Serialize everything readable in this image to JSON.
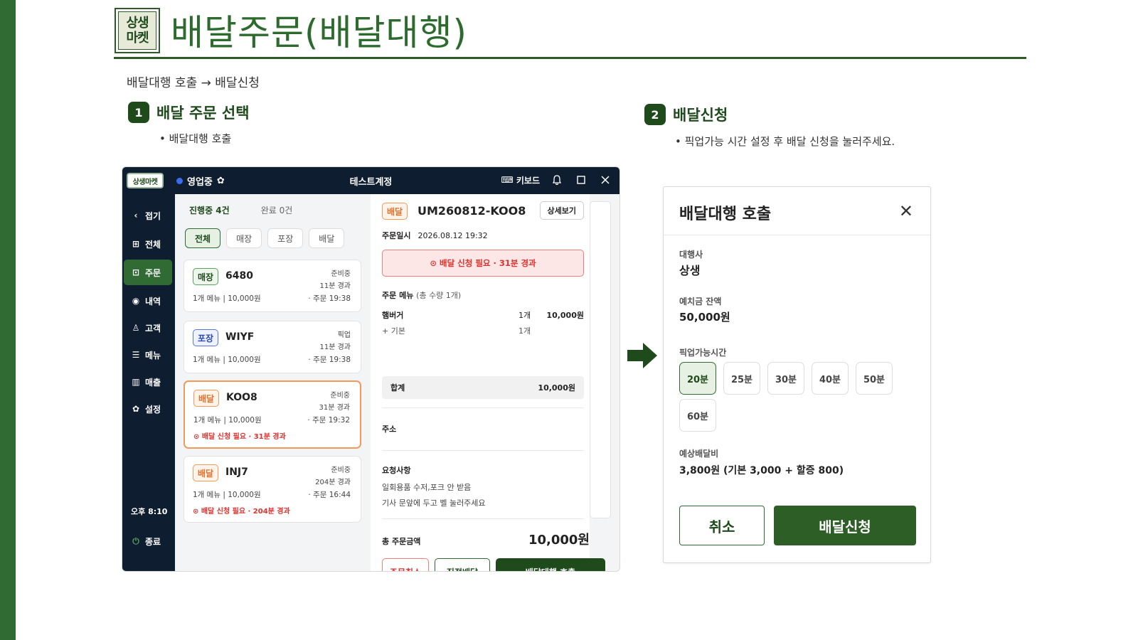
{
  "header": {
    "logo_line1": "상생",
    "logo_line2": "마켓",
    "title": "배달주문(배달대행)",
    "flow": "배달대행 호출 → 배달신청"
  },
  "steps": [
    {
      "num": "1",
      "title": "배달 주문 선택",
      "bullet": "• 배달대행 호출"
    },
    {
      "num": "2",
      "title": "배달신청",
      "bullet": "• 픽업가능 시간 설정 후 배달 신청을 눌러주세요."
    }
  ],
  "app": {
    "logo": "상생마켓",
    "status": "영업중",
    "account": "테스트계정",
    "keyboard": "키보드",
    "sidebar": [
      {
        "icon": "‹",
        "label": "접기"
      },
      {
        "icon": "⊞",
        "label": "전체"
      },
      {
        "icon": "⊡",
        "label": "주문"
      },
      {
        "icon": "◉",
        "label": "내역"
      },
      {
        "icon": "♙",
        "label": "고객"
      },
      {
        "icon": "☰",
        "label": "메뉴"
      },
      {
        "icon": "▥",
        "label": "매출"
      },
      {
        "icon": "✿",
        "label": "설정"
      }
    ],
    "clock": "오후 8:10",
    "exit": "종료",
    "counts": {
      "in_progress": "진행중 4건",
      "done": "완료 0건"
    },
    "filters": [
      "전체",
      "매장",
      "포장",
      "배달"
    ],
    "orders": [
      {
        "type": "매장",
        "code": "6480",
        "status": "준비중",
        "elapsed": "11분 경과",
        "menu": "1개 메뉴  |  10,000원",
        "time": "· 주문 19:38",
        "warn": ""
      },
      {
        "type": "포장",
        "code": "WIYF",
        "status": "픽업",
        "elapsed": "11분 경과",
        "menu": "1개 메뉴  |  10,000원",
        "time": "· 주문 19:38",
        "warn": ""
      },
      {
        "type": "배달",
        "code": "KOO8",
        "status": "준비중",
        "elapsed": "31분 경과",
        "menu": "1개 메뉴  |  10,000원",
        "time": "· 주문 19:32",
        "warn": "⊙ 배달 신청 필요 · 31분 경과"
      },
      {
        "type": "배달",
        "code": "INJ7",
        "status": "준비중",
        "elapsed": "204분 경과",
        "menu": "1개 메뉴  |  10,000원",
        "time": "· 주문 16:44",
        "warn": "⊙ 배달 신청 필요 · 204분 경과"
      }
    ],
    "detail": {
      "type": "배달",
      "order_no": "UM260812-KOO8",
      "more": "상세보기",
      "date_label": "주문일시",
      "date": "2026.08.12 19:32",
      "alert": "⊙ 배달 신청 필요 · 31분 경과",
      "menu_label": "주문 메뉴",
      "menu_count": "(총 수량 1개)",
      "item_name": "햄버거",
      "item_qty": "1개",
      "item_price": "10,000원",
      "option_name": "+ 기본",
      "option_qty": "1개",
      "total_label": "합계",
      "total": "10,000원",
      "address_label": "주소",
      "request_label": "요청사항",
      "request1": "일회용품 수저,포크 안 받음",
      "request2": "기사 문앞에 두고 벨 눌러주세요",
      "sum_label": "총 주문금액",
      "sum": "10,000원",
      "btn_cancel": "주문취소",
      "btn_direct": "직접배달",
      "btn_call": "배달대행 호출"
    }
  },
  "modal": {
    "title": "배달대행 호출",
    "agency_label": "대행사",
    "agency": "상생",
    "deposit_label": "예치금 잔액",
    "deposit": "50,000원",
    "pickup_label": "픽업가능시간",
    "times": [
      "20분",
      "25분",
      "30분",
      "40분",
      "50분",
      "60분"
    ],
    "selected_time": "20분",
    "fee_label": "예상배달비",
    "fee": "3,800원 (기본 3,000 + 할증 800)",
    "cancel": "취소",
    "submit": "배달신청"
  },
  "colors": {
    "brand": "#2f6b33",
    "dark": "#0f1d30",
    "alert": "#e0312d",
    "delivery": "#f29a59"
  }
}
